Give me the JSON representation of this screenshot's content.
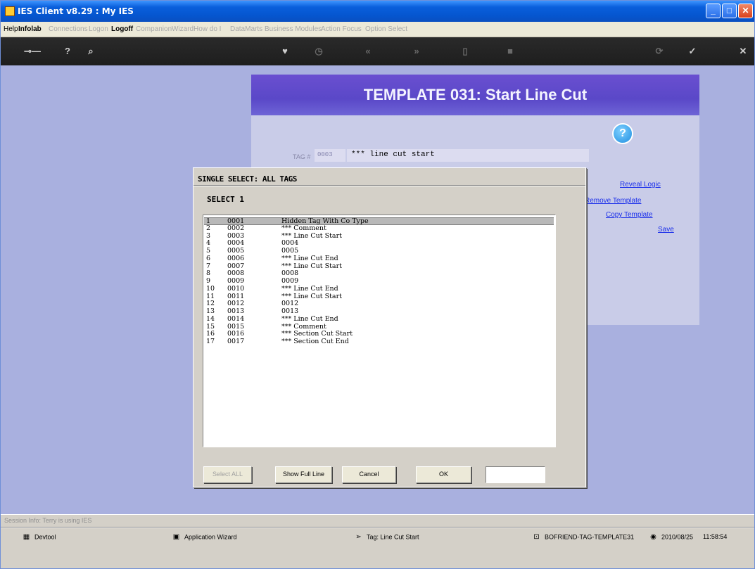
{
  "window": {
    "title": "IES Client v8.29 : My IES"
  },
  "menu": {
    "items": [
      {
        "label": "Help",
        "state": "enabled"
      },
      {
        "label": "Infolab",
        "state": "enabled"
      },
      {
        "label": "Connections",
        "state": "disabled"
      },
      {
        "label": "Logon",
        "state": "disabled"
      },
      {
        "label": "Logoff",
        "state": "bold"
      },
      {
        "label": "Companion",
        "state": "disabled"
      },
      {
        "label": "Wizard",
        "state": "disabled"
      },
      {
        "label": "How do I",
        "state": "disabled"
      },
      {
        "label": "DataMarts",
        "state": "disabled"
      },
      {
        "label": "Business Modules",
        "state": "disabled"
      },
      {
        "label": "Action Focus",
        "state": "disabled"
      },
      {
        "label": "Option Select",
        "state": "disabled"
      }
    ]
  },
  "toolbar": {
    "icons": [
      "key-icon",
      "help-icon",
      "search-icon",
      "heart-icon",
      "clock-icon",
      "rewind-icon",
      "fast-forward-icon",
      "document-icon",
      "stop-icon",
      "refresh-icon",
      "check-icon",
      "close-icon"
    ]
  },
  "template": {
    "header": "TEMPLATE 031: Start Line Cut",
    "tag_label": "TAG #",
    "tag_value": "0003",
    "tag_description": "*** line cut start",
    "links": [
      "Reveal Logic",
      "Remove Template",
      "Copy Template",
      "Save"
    ]
  },
  "dialog": {
    "title": "SINGLE SELECT: ALL TAGS",
    "select_label": "SELECT 1",
    "rows": [
      {
        "n": "1",
        "code": "0001",
        "desc": "Hidden Tag With Co Type"
      },
      {
        "n": "2",
        "code": "0002",
        "desc": "*** Comment"
      },
      {
        "n": "3",
        "code": "0003",
        "desc": "*** Line Cut Start"
      },
      {
        "n": "4",
        "code": "0004",
        "desc": "0004"
      },
      {
        "n": "5",
        "code": "0005",
        "desc": "0005"
      },
      {
        "n": "6",
        "code": "0006",
        "desc": "*** Line Cut End"
      },
      {
        "n": "7",
        "code": "0007",
        "desc": "*** Line Cut Start"
      },
      {
        "n": "8",
        "code": "0008",
        "desc": "0008"
      },
      {
        "n": "9",
        "code": "0009",
        "desc": "0009"
      },
      {
        "n": "10",
        "code": "0010",
        "desc": "*** Line Cut End"
      },
      {
        "n": "11",
        "code": "0011",
        "desc": "*** Line Cut Start"
      },
      {
        "n": "12",
        "code": "0012",
        "desc": "0012"
      },
      {
        "n": "13",
        "code": "0013",
        "desc": "0013"
      },
      {
        "n": "14",
        "code": "0014",
        "desc": "*** Line Cut End"
      },
      {
        "n": "15",
        "code": "0015",
        "desc": "*** Comment"
      },
      {
        "n": "16",
        "code": "0016",
        "desc": "*** Section Cut Start"
      },
      {
        "n": "17",
        "code": "0017",
        "desc": "*** Section Cut End"
      }
    ],
    "buttons": {
      "select_all": "Select ALL",
      "show_full_line": "Show Full Line",
      "cancel": "Cancel",
      "ok": "OK"
    }
  },
  "status": {
    "session": "Session Info: Terry is using IES",
    "items": {
      "devtool": "Devtool",
      "wizard": "Application Wizard",
      "tag": "Tag: Line Cut Start",
      "path": "BOFRIEND-TAG-TEMPLATE31",
      "date": "2010/08/25",
      "time": "11:58:54"
    }
  }
}
